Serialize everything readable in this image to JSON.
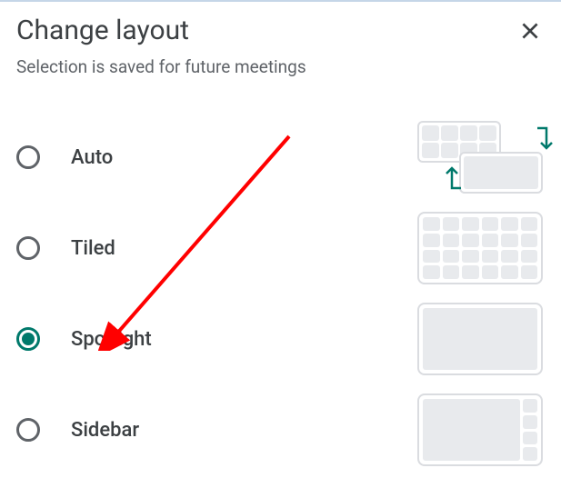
{
  "dialog": {
    "title": "Change layout",
    "subtitle": "Selection is saved for future meetings"
  },
  "options": [
    {
      "id": "auto",
      "label": "Auto",
      "selected": false
    },
    {
      "id": "tiled",
      "label": "Tiled",
      "selected": false
    },
    {
      "id": "spotlight",
      "label": "Spotlight",
      "selected": true
    },
    {
      "id": "sidebar",
      "label": "Sidebar",
      "selected": false
    }
  ],
  "colors": {
    "accent": "#00796b",
    "text": "#3c4043",
    "textSecondary": "#5f6368",
    "tile": "#e8eaed",
    "border": "#dadce0",
    "annotation": "#ff0000"
  }
}
